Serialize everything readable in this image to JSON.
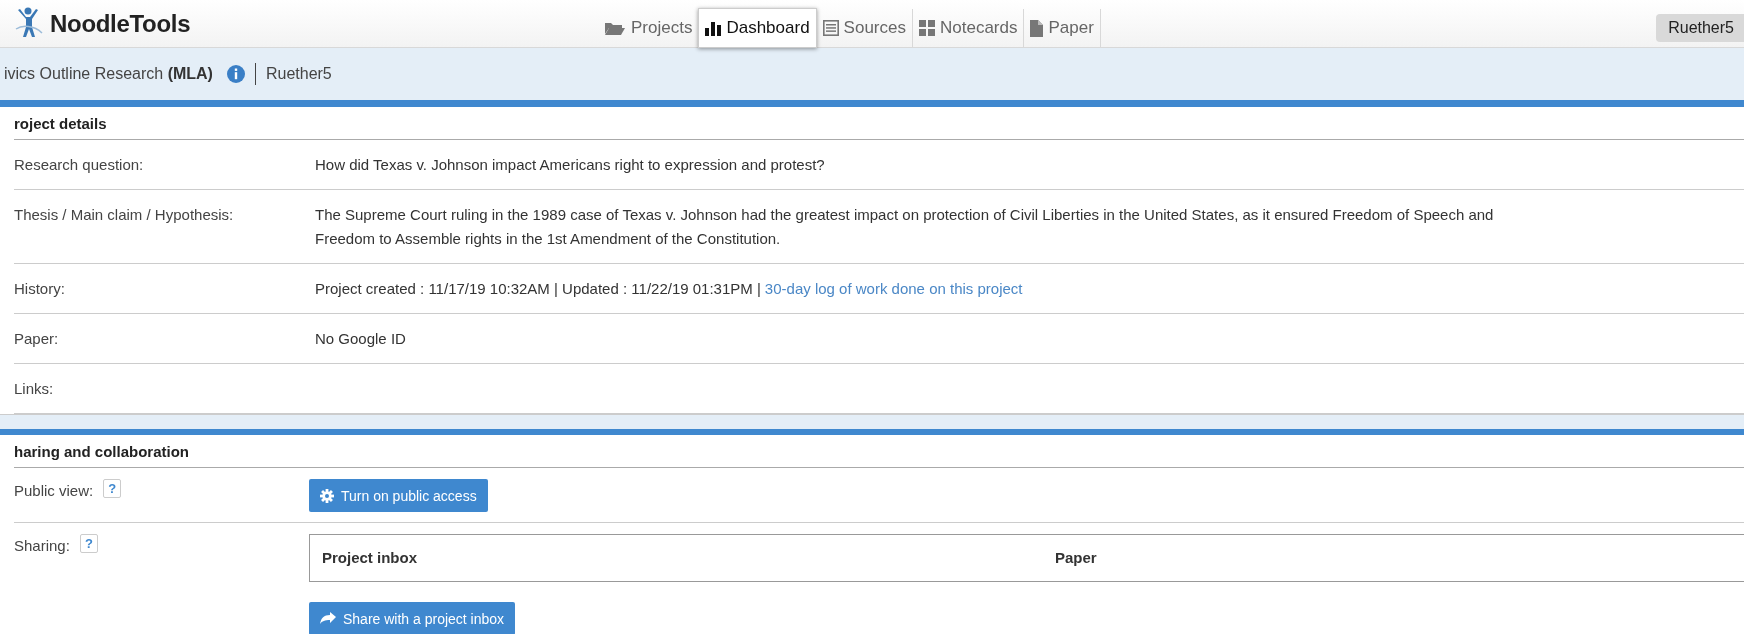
{
  "app": {
    "logo_text": "NoodleTools"
  },
  "nav_tabs": [
    {
      "label": "Projects",
      "selected": false
    },
    {
      "label": "Dashboard",
      "selected": true
    },
    {
      "label": "Sources",
      "selected": false
    },
    {
      "label": "Notecards",
      "selected": false
    },
    {
      "label": "Paper",
      "selected": false
    }
  ],
  "user_menu": {
    "label": "Ruether5"
  },
  "project_bar": {
    "title": "ivics Outline Research",
    "style": "(MLA)",
    "user": "Ruether5"
  },
  "project_details": {
    "heading": "roject details",
    "rows": [
      {
        "label": "Research question:",
        "value": "How did Texas v. Johnson impact Americans right to expression and protest?"
      },
      {
        "label": "Thesis / Main claim / Hypothesis:",
        "value": "The Supreme Court ruling in the 1989 case of Texas v. Johnson had the greatest impact on protection of Civil Liberties in the United States, as it ensured Freedom of Speech and Freedom to Assemble rights in the 1st Amendment of the Constitution."
      },
      {
        "label": "History:",
        "value": "Project created : 11/17/19 10:32AM | Updated : 11/22/19 01:31PM |",
        "link": "30-day log of work done on this project"
      },
      {
        "label": "Paper:",
        "value": "No Google ID"
      },
      {
        "label": "Links:"
      }
    ]
  },
  "sharing": {
    "heading": "haring and collaboration",
    "public_view": {
      "label": "Public view:",
      "help": "?",
      "button": "Turn on public access"
    },
    "sharing": {
      "label": "Sharing:",
      "help": "?",
      "table_columns": [
        "Project inbox",
        "Paper"
      ],
      "button": "Share with a project inbox"
    }
  }
}
